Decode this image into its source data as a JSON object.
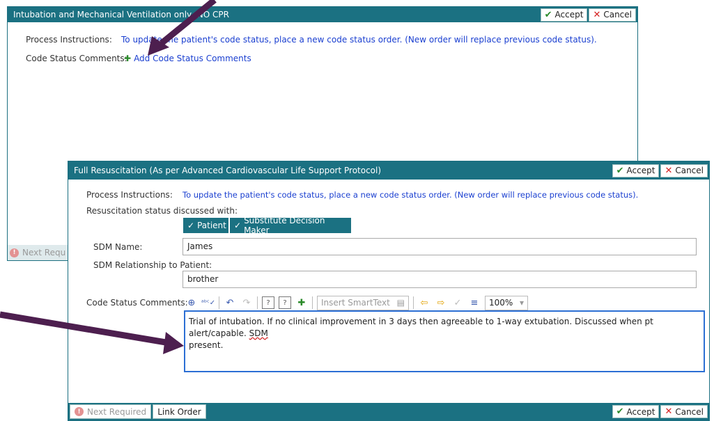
{
  "back_panel": {
    "title": "Intubation and Mechanical Ventilation only, NO CPR",
    "accept_label": "Accept",
    "cancel_label": "Cancel",
    "process_label": "Process Instructions:",
    "process_text": "To update the patient's code status, place a new code status order. (New order will replace previous code status).",
    "comments_label": "Code Status Comments:",
    "add_comments_link": "Add Code Status Comments",
    "next_required": "Next Requ"
  },
  "front_panel": {
    "title": "Full Resuscitation (As per Advanced Cardiovascular Life Support Protocol)",
    "accept_label": "Accept",
    "cancel_label": "Cancel",
    "process_label": "Process Instructions:",
    "process_text": "To update the patient's code status, place a new code status order. (New order will replace previous code status).",
    "discussed_label": "Resuscitation status discussed with:",
    "toggles": [
      "Patient",
      "Substitute Decision Maker"
    ],
    "sdm_name_label": "SDM Name:",
    "sdm_name_value": "James",
    "sdm_rel_label": "SDM Relationship to Patient:",
    "sdm_rel_value": "brother",
    "comments_label": "Code Status Comments:",
    "smarttext_placeholder": "Insert SmartText",
    "zoom": "100%",
    "comment_text_a": "Trial of intubation. If no clinical improvement in 3 days then agreeable to 1-way extubation. Discussed when pt alert/capable. ",
    "comment_text_sdm": "SDM",
    "comment_text_b": "present.",
    "footer": {
      "next_required": "Next Required",
      "link_order": "Link Order",
      "accept_label": "Accept",
      "cancel_label": "Cancel"
    }
  },
  "colors": {
    "header": "#1b7182",
    "link": "#1a3fd0",
    "arrow": "#4d1f4f"
  }
}
